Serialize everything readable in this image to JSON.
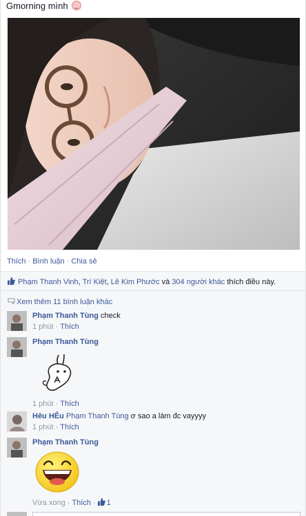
{
  "post": {
    "caption": "Gmorning mình",
    "caption_emoji": "grinning-face-emoji"
  },
  "actions": {
    "like": "Thích",
    "comment": "Bình luận",
    "share": "Chia sẻ",
    "separator": "·"
  },
  "likes": {
    "names": [
      "Phạm Thanh Vinh",
      "Trí Kiệt",
      "Lê Kim Phước"
    ],
    "name_sep": ", ",
    "and": " và ",
    "others": "304 người khác",
    "suffix": " thích điều này."
  },
  "more_comments": "Xem thêm 11 bình luận khác",
  "comments": [
    {
      "author": "Phạm Thanh Tùng",
      "text": "check",
      "time": "1 phút",
      "like": "Thích"
    },
    {
      "author": "Phạm Thanh Tùng",
      "text": "",
      "time": "1 phút",
      "like": "Thích",
      "sticker": "rabbit-sticker"
    },
    {
      "author": "Hêu HÊu",
      "mention": "Phạm Thanh Tùng",
      "text": " ơ sao a làm đc vayyyy",
      "time": "1 phút",
      "like": "Thích"
    },
    {
      "author": "Phạm Thanh Tùng",
      "text": "",
      "time": "Vừa xong",
      "like": "Thích",
      "like_count": "1",
      "sticker": "laughing-face-sticker"
    }
  ],
  "colors": {
    "link": "#3b5998",
    "muted": "#9197a3",
    "ufi_bg": "#f6f7f9"
  }
}
